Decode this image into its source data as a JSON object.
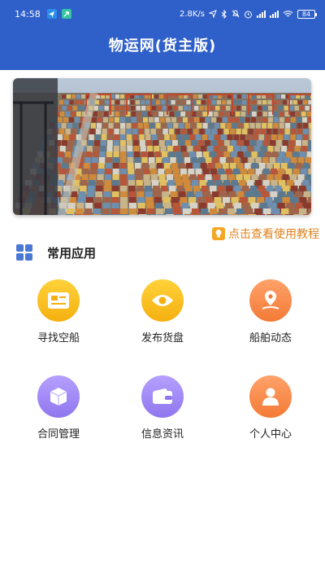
{
  "status_bar": {
    "time": "14:58",
    "net_speed": "2.8K/s",
    "battery": "84"
  },
  "header": {
    "title": "物运网(货主版)",
    "color": "#2f5fc9"
  },
  "banner": {
    "icon": "container-port-photo"
  },
  "tutorial": {
    "label": "点击查看使用教程",
    "icon": "lightbulb-icon"
  },
  "section": {
    "title": "常用应用",
    "icon": "grid-icon"
  },
  "apps": [
    {
      "label": "寻找空船",
      "icon": "id-card-icon",
      "color": "#f5b00f"
    },
    {
      "label": "发布货盘",
      "icon": "eye-icon",
      "color": "#f5b00f"
    },
    {
      "label": "船舶动态",
      "icon": "location-pin-icon",
      "color": "#f47a36"
    },
    {
      "label": "合同管理",
      "icon": "cube-icon",
      "color": "#8f76ee"
    },
    {
      "label": "信息资讯",
      "icon": "wallet-icon",
      "color": "#8f76ee"
    },
    {
      "label": "个人中心",
      "icon": "person-icon",
      "color": "#f47a36"
    }
  ]
}
